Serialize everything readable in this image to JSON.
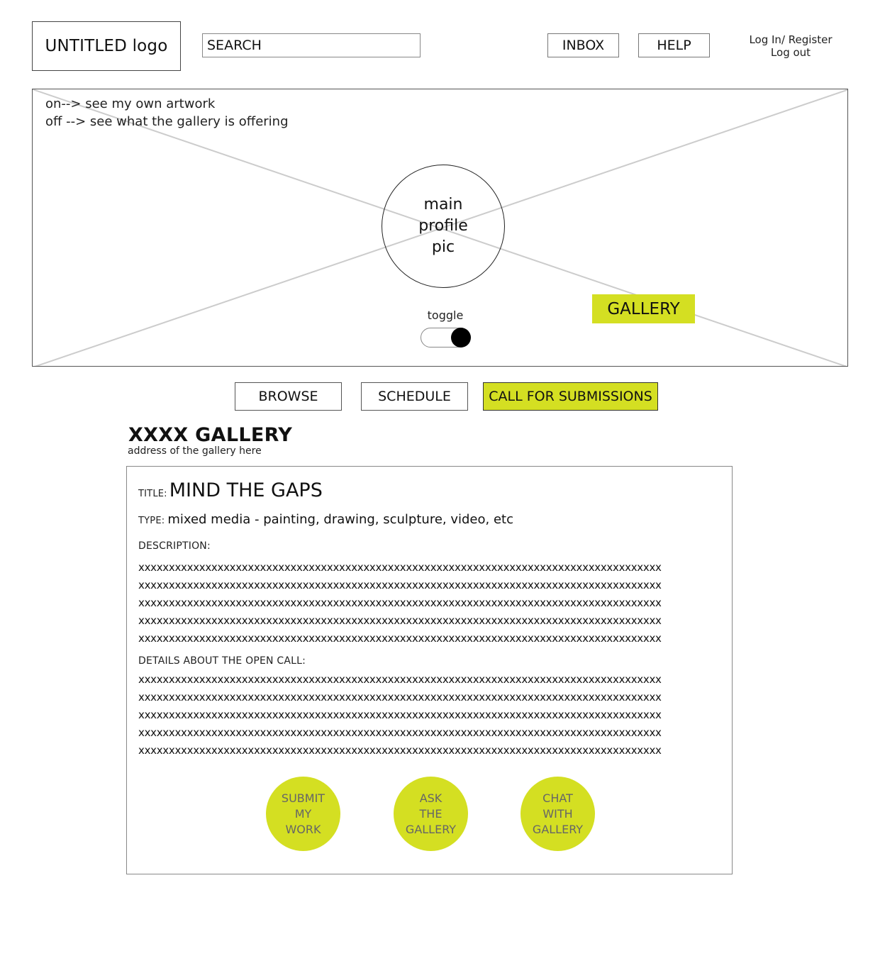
{
  "header": {
    "logo": "UNTITLED logo",
    "search_placeholder": "SEARCH",
    "inbox_label": "INBOX",
    "help_label": "HELP",
    "login_register": "Log In/ Register",
    "logout": "Log out"
  },
  "hero": {
    "note_on": "on--> see my own artwork",
    "note_off": "off --> see what the gallery is offering",
    "profile_pic_text": "main\nprofile\npic",
    "toggle_label": "toggle",
    "toggle_state": "on",
    "gallery_tag": "GALLERY"
  },
  "nav": {
    "browse": "BROWSE",
    "schedule": "SCHEDULE",
    "call_for_submissions": "CALL FOR SUBMISSIONS",
    "active": "call_for_submissions"
  },
  "gallery": {
    "name": "XXXX GALLERY",
    "address": "address of the gallery here"
  },
  "call": {
    "title_label": "TITLE:",
    "title": "MIND THE GAPS",
    "type_label": "TYPE:",
    "type": "mixed media - painting, drawing, sculpture, video, etc",
    "description_label": "DESCRIPTION:",
    "description_lines": [
      "xxxxxxxxxxxxxxxxxxxxxxxxxxxxxxxxxxxxxxxxxxxxxxxxxxxxxxxxxxxxxxxxxxxxxxxxxxxxxxxxxxxxxx",
      "xxxxxxxxxxxxxxxxxxxxxxxxxxxxxxxxxxxxxxxxxxxxxxxxxxxxxxxxxxxxxxxxxxxxxxxxxxxxxxxxxxxxxx",
      "xxxxxxxxxxxxxxxxxxxxxxxxxxxxxxxxxxxxxxxxxxxxxxxxxxxxxxxxxxxxxxxxxxxxxxxxxxxxxxxxxxxxxx",
      "xxxxxxxxxxxxxxxxxxxxxxxxxxxxxxxxxxxxxxxxxxxxxxxxxxxxxxxxxxxxxxxxxxxxxxxxxxxxxxxxxxxxxx",
      "xxxxxxxxxxxxxxxxxxxxxxxxxxxxxxxxxxxxxxxxxxxxxxxxxxxxxxxxxxxxxxxxxxxxxxxxxxxxxxxxxxxxxx"
    ],
    "details_label": "DETAILS ABOUT THE OPEN CALL:",
    "details_lines": [
      "xxxxxxxxxxxxxxxxxxxxxxxxxxxxxxxxxxxxxxxxxxxxxxxxxxxxxxxxxxxxxxxxxxxxxxxxxxxxxxxxxxxxxx",
      "xxxxxxxxxxxxxxxxxxxxxxxxxxxxxxxxxxxxxxxxxxxxxxxxxxxxxxxxxxxxxxxxxxxxxxxxxxxxxxxxxxxxxx",
      "xxxxxxxxxxxxxxxxxxxxxxxxxxxxxxxxxxxxxxxxxxxxxxxxxxxxxxxxxxxxxxxxxxxxxxxxxxxxxxxxxxxxxx",
      "xxxxxxxxxxxxxxxxxxxxxxxxxxxxxxxxxxxxxxxxxxxxxxxxxxxxxxxxxxxxxxxxxxxxxxxxxxxxxxxxxxxxxx",
      "xxxxxxxxxxxxxxxxxxxxxxxxxxxxxxxxxxxxxxxxxxxxxxxxxxxxxxxxxxxxxxxxxxxxxxxxxxxxxxxxxxxxxx"
    ],
    "actions": {
      "submit": "SUBMIT\nMY\nWORK",
      "ask": "ASK\nTHE\nGALLERY",
      "chat": "CHAT\nWITH\nGALLERY"
    }
  },
  "colors": {
    "accent": "#d4df22",
    "placeholder_line": "#cccccc",
    "border": "#555555"
  }
}
